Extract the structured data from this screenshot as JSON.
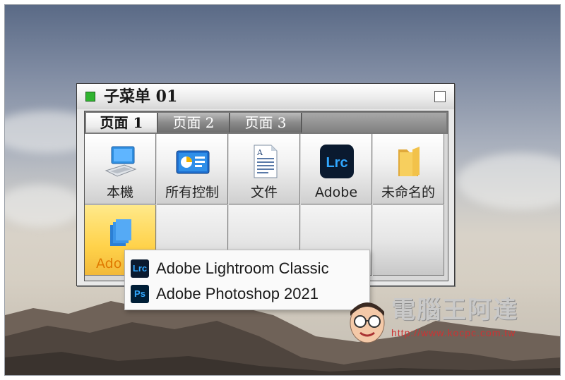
{
  "window": {
    "title": "子菜单 01",
    "tabs": [
      {
        "label": "页面 1",
        "active": true
      },
      {
        "label": "页面 2",
        "active": false
      },
      {
        "label": "页面 3",
        "active": false
      }
    ],
    "grid": [
      {
        "label": "本機",
        "icon": "computer-icon"
      },
      {
        "label": "所有控制",
        "icon": "control-panel-icon"
      },
      {
        "label": "文件",
        "icon": "document-icon"
      },
      {
        "label": "Adobe",
        "icon": "lightroom-icon"
      },
      {
        "label": "未命名的",
        "icon": "folder-icon"
      },
      {
        "label": "Ado",
        "icon": "stack-icon",
        "selected": true
      }
    ]
  },
  "popup": {
    "items": [
      {
        "label": "Adobe Lightroom Classic",
        "icon_text": "Lrc",
        "icon": "lightroom-classic-icon"
      },
      {
        "label": "Adobe Photoshop 2021",
        "icon_text": "Ps",
        "icon": "photoshop-icon"
      }
    ]
  },
  "watermark": {
    "brand": "電腦王阿達",
    "url": "http://www.kocpc.com.tw"
  },
  "colors": {
    "lightroom_bg": "#0a1a2f",
    "lightroom_fg": "#31a8ff",
    "selection": "#ffd24a",
    "title_square": "#2fb32f"
  }
}
